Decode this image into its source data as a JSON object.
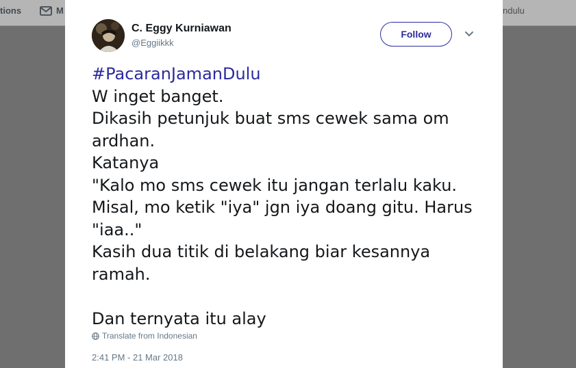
{
  "nav": {
    "notifications_label": "tions",
    "messages_label": "M",
    "right_label": "ndulu"
  },
  "tweet": {
    "author_name": "C. Eggy Kurniawan",
    "author_handle": "@Eggiikkk",
    "follow_label": "Follow",
    "hashtag": "#PacaranJamanDulu",
    "body": "W inget banget.\nDikasih petunjuk buat sms cewek sama om\nardhan.\nKatanya\n\"Kalo mo sms cewek itu jangan terlalu kaku.\nMisal, mo ketik \"iya\" jgn iya doang gitu. Harus\n\"iaa..\"\nKasih dua titik di belakang biar kesannya\nramah.\n\nDan ternyata itu alay",
    "translate_label": "Translate from Indonesian",
    "timestamp": "2:41 PM - 21 Mar 2018"
  },
  "colors": {
    "accent": "#2b2aa0",
    "text": "#14171a",
    "muted": "#657786",
    "overlay": "#6e6e6e"
  }
}
